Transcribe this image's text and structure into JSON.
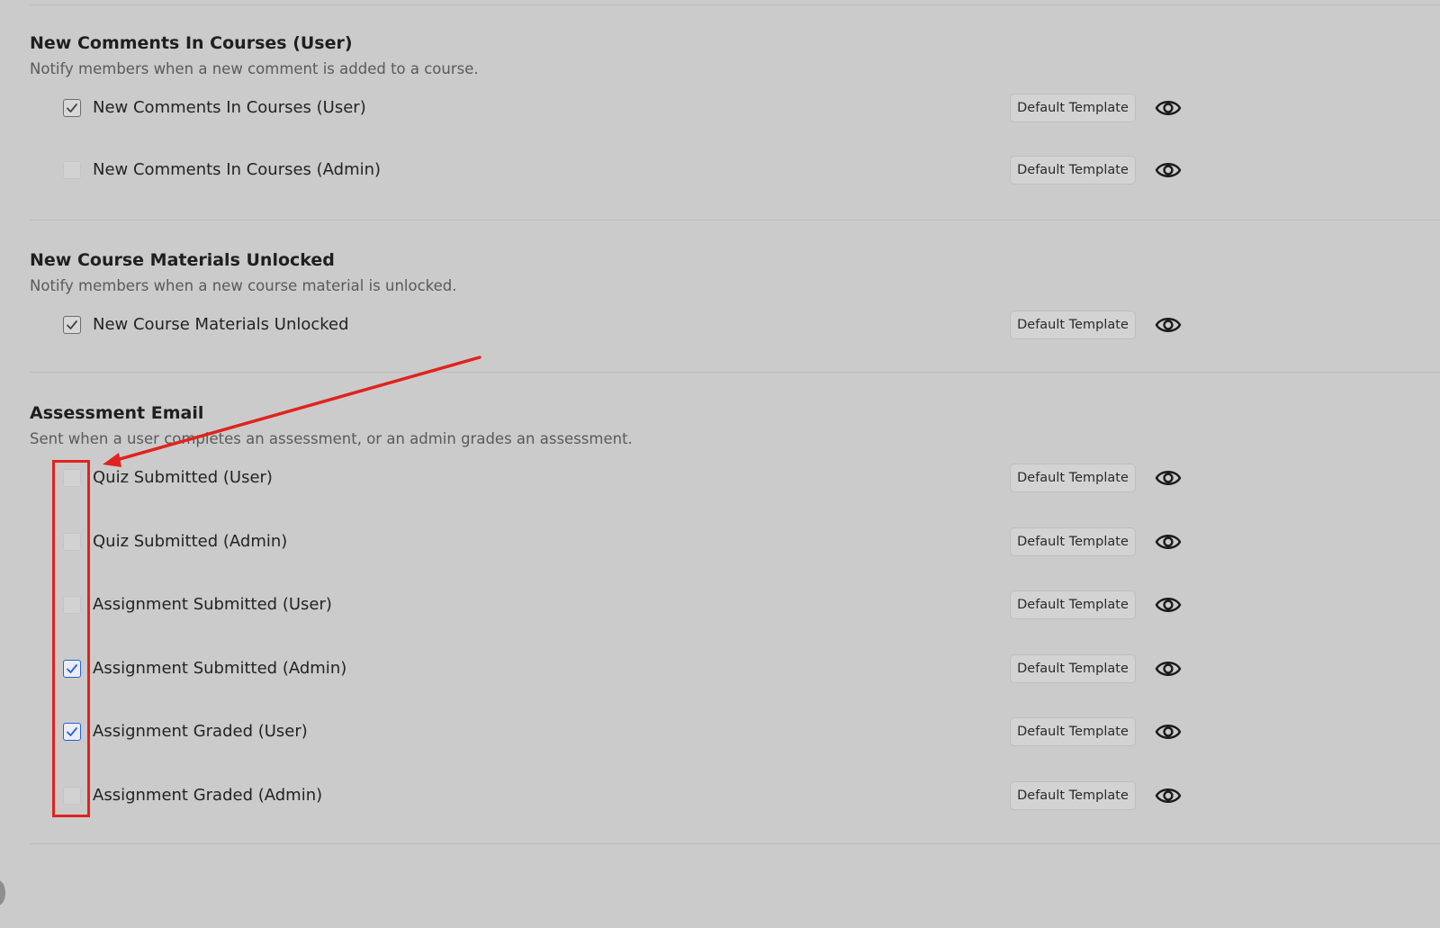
{
  "colors": {
    "background": "#cbcbcb",
    "checkbox_blue": "#2463d6",
    "annotation_red": "#e0231e"
  },
  "template_button_label": "Default Template",
  "sections": [
    {
      "title": "New Comments In Courses (User)",
      "description": "Notify members when a new comment is added to a course.",
      "items": [
        {
          "label": "New Comments In Courses (User)",
          "checked": true,
          "style": "gray"
        },
        {
          "label": "New Comments In Courses (Admin)",
          "checked": false,
          "style": "none"
        }
      ]
    },
    {
      "title": "New Course Materials Unlocked",
      "description": "Notify members when a new course material is unlocked.",
      "items": [
        {
          "label": "New Course Materials Unlocked",
          "checked": true,
          "style": "gray"
        }
      ]
    },
    {
      "title": "Assessment Email",
      "description": "Sent when a user completes an assessment, or an admin grades an assessment.",
      "items": [
        {
          "label": "Quiz Submitted (User)",
          "checked": false,
          "style": "none"
        },
        {
          "label": "Quiz Submitted (Admin)",
          "checked": false,
          "style": "none"
        },
        {
          "label": "Assignment Submitted (User)",
          "checked": false,
          "style": "none"
        },
        {
          "label": "Assignment Submitted (Admin)",
          "checked": true,
          "style": "blue"
        },
        {
          "label": "Assignment Graded (User)",
          "checked": true,
          "style": "blue"
        },
        {
          "label": "Assignment Graded (Admin)",
          "checked": false,
          "style": "none"
        }
      ]
    }
  ],
  "icons": {
    "check": "check-icon",
    "preview": "eye-icon"
  }
}
